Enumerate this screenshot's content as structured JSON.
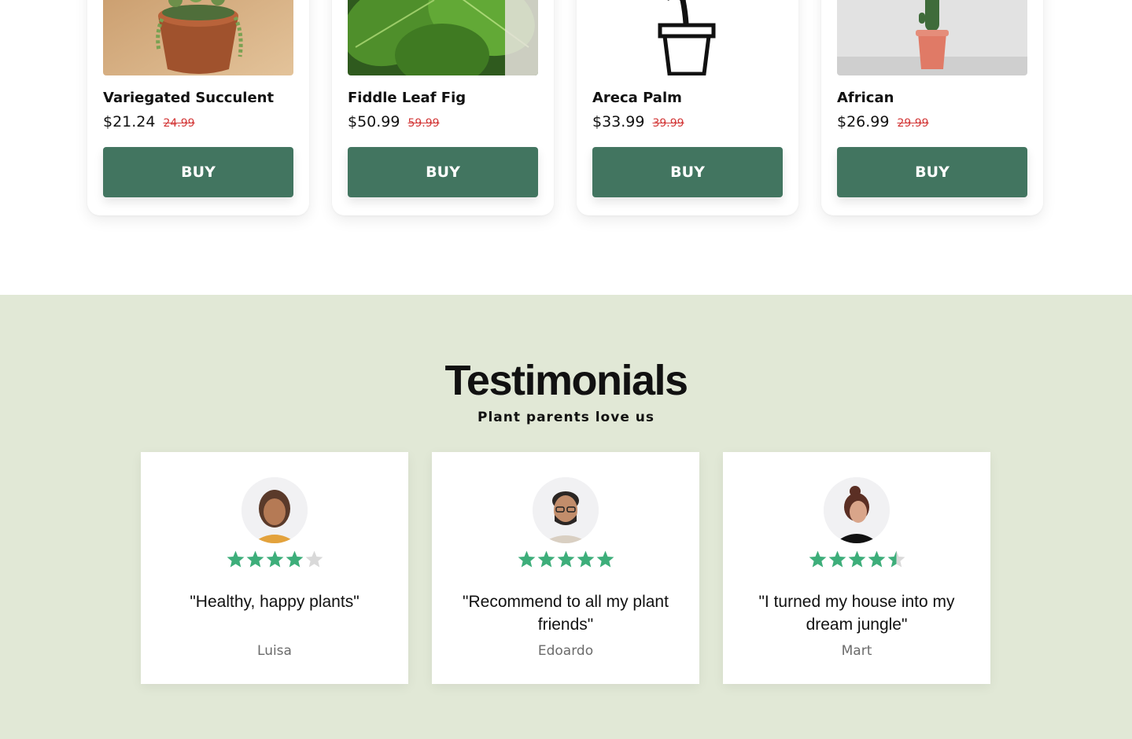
{
  "products": [
    {
      "name": "Variegated Succulent",
      "price": "$21.24",
      "old_price": "24.99",
      "buy_label": "BUY"
    },
    {
      "name": "Fiddle Leaf Fig",
      "price": "$50.99",
      "old_price": "59.99",
      "buy_label": "BUY"
    },
    {
      "name": "Areca Palm",
      "price": "$33.99",
      "old_price": "39.99",
      "buy_label": "BUY"
    },
    {
      "name": "African",
      "price": "$26.99",
      "old_price": "29.99",
      "buy_label": "BUY"
    }
  ],
  "testimonials": {
    "title": "Testimonials",
    "subtitle": "Plant parents love us",
    "items": [
      {
        "quote": "\"Healthy, happy plants\"",
        "author": "Luisa",
        "rating": 4
      },
      {
        "quote": "\"Recommend to all my plant friends\"",
        "author": "Edoardo",
        "rating": 5
      },
      {
        "quote": "\"I turned my house into my dream jungle\"",
        "author": "Mart",
        "rating": 4.5
      }
    ]
  },
  "colors": {
    "accent": "#427560",
    "section_bg": "#e1e8d6",
    "star": "#3dae7a",
    "star_empty": "#d9d9d9",
    "old_price": "#d33838"
  }
}
